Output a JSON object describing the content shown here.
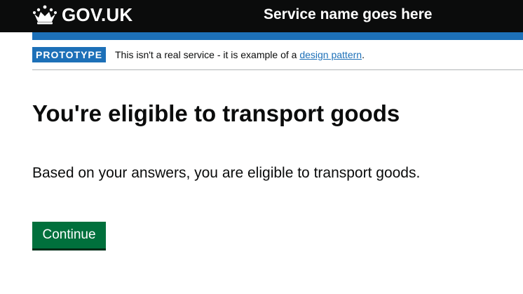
{
  "header": {
    "logo_text": "GOV.UK",
    "logo_icon": "crown-icon",
    "service_name": "Service name goes here"
  },
  "phase_banner": {
    "tag": "PROTOTYPE",
    "text_before": "This isn't a real service - it is example of a ",
    "link_text": "design pattern",
    "text_after": "."
  },
  "main": {
    "heading": "You're eligible to transport goods",
    "body": "Based on your answers, you are eligible to transport goods.",
    "continue_label": "Continue"
  },
  "colors": {
    "header_bg": "#0b0c0c",
    "brand_blue": "#1d70b8",
    "button_green": "#00703c",
    "text": "#0b0c0c"
  }
}
